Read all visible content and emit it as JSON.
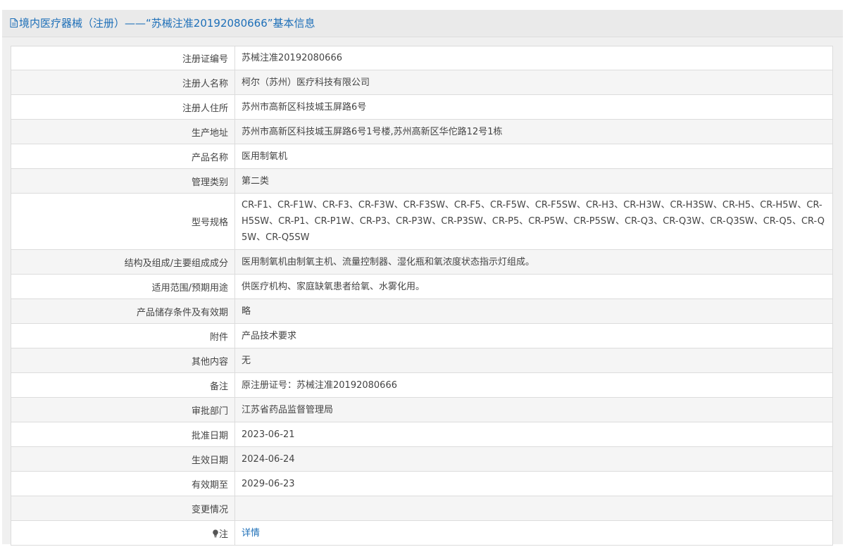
{
  "header": {
    "icon": "document-icon",
    "title": "境内医疗器械（注册）——“苏械注准20192080666”基本信息"
  },
  "rows": [
    {
      "label": "注册证编号",
      "value": "苏械注准20192080666"
    },
    {
      "label": "注册人名称",
      "value": "柯尔（苏州）医疗科技有限公司"
    },
    {
      "label": "注册人住所",
      "value": "苏州市高新区科技城玉屏路6号"
    },
    {
      "label": "生产地址",
      "value": "苏州市高新区科技城玉屏路6号1号楼,苏州高新区华佗路12号1栋"
    },
    {
      "label": "产品名称",
      "value": "医用制氧机"
    },
    {
      "label": "管理类别",
      "value": "第二类"
    },
    {
      "label": "型号规格",
      "value": "CR-F1、CR-F1W、CR-F3、CR-F3W、CR-F3SW、CR-F5、CR-F5W、CR-F5SW、CR-H3、CR-H3W、CR-H3SW、CR-H5、CR-H5W、CR-H5SW、CR-P1、CR-P1W、CR-P3、CR-P3W、CR-P3SW、CR-P5、CR-P5W、CR-P5SW、CR-Q3、CR-Q3W、CR-Q3SW、CR-Q5、CR-Q5W、CR-Q5SW"
    },
    {
      "label": "结构及组成/主要组成成分",
      "value": "医用制氧机由制氧主机、流量控制器、湿化瓶和氧浓度状态指示灯组成。"
    },
    {
      "label": "适用范围/预期用途",
      "value": "供医疗机构、家庭缺氧患者给氧、水雾化用。"
    },
    {
      "label": "产品储存条件及有效期",
      "value": "略"
    },
    {
      "label": "附件",
      "value": "产品技术要求"
    },
    {
      "label": "其他内容",
      "value": "无"
    },
    {
      "label": "备注",
      "value": "原注册证号：苏械注准20192080666"
    },
    {
      "label": "审批部门",
      "value": "江苏省药品监督管理局"
    },
    {
      "label": "批准日期",
      "value": "2023-06-21"
    },
    {
      "label": "生效日期",
      "value": "2024-06-24"
    },
    {
      "label": "有效期至",
      "value": "2029-06-23"
    },
    {
      "label": "变更情况",
      "value": ""
    }
  ],
  "note": {
    "icon": "lightbulb-icon",
    "label": "注",
    "link": "详情"
  },
  "colors": {
    "link": "#1d6fb8",
    "header_bg": "#eaeaea",
    "row_alt": "#f5f5f5",
    "border": "#dcdcdc"
  }
}
